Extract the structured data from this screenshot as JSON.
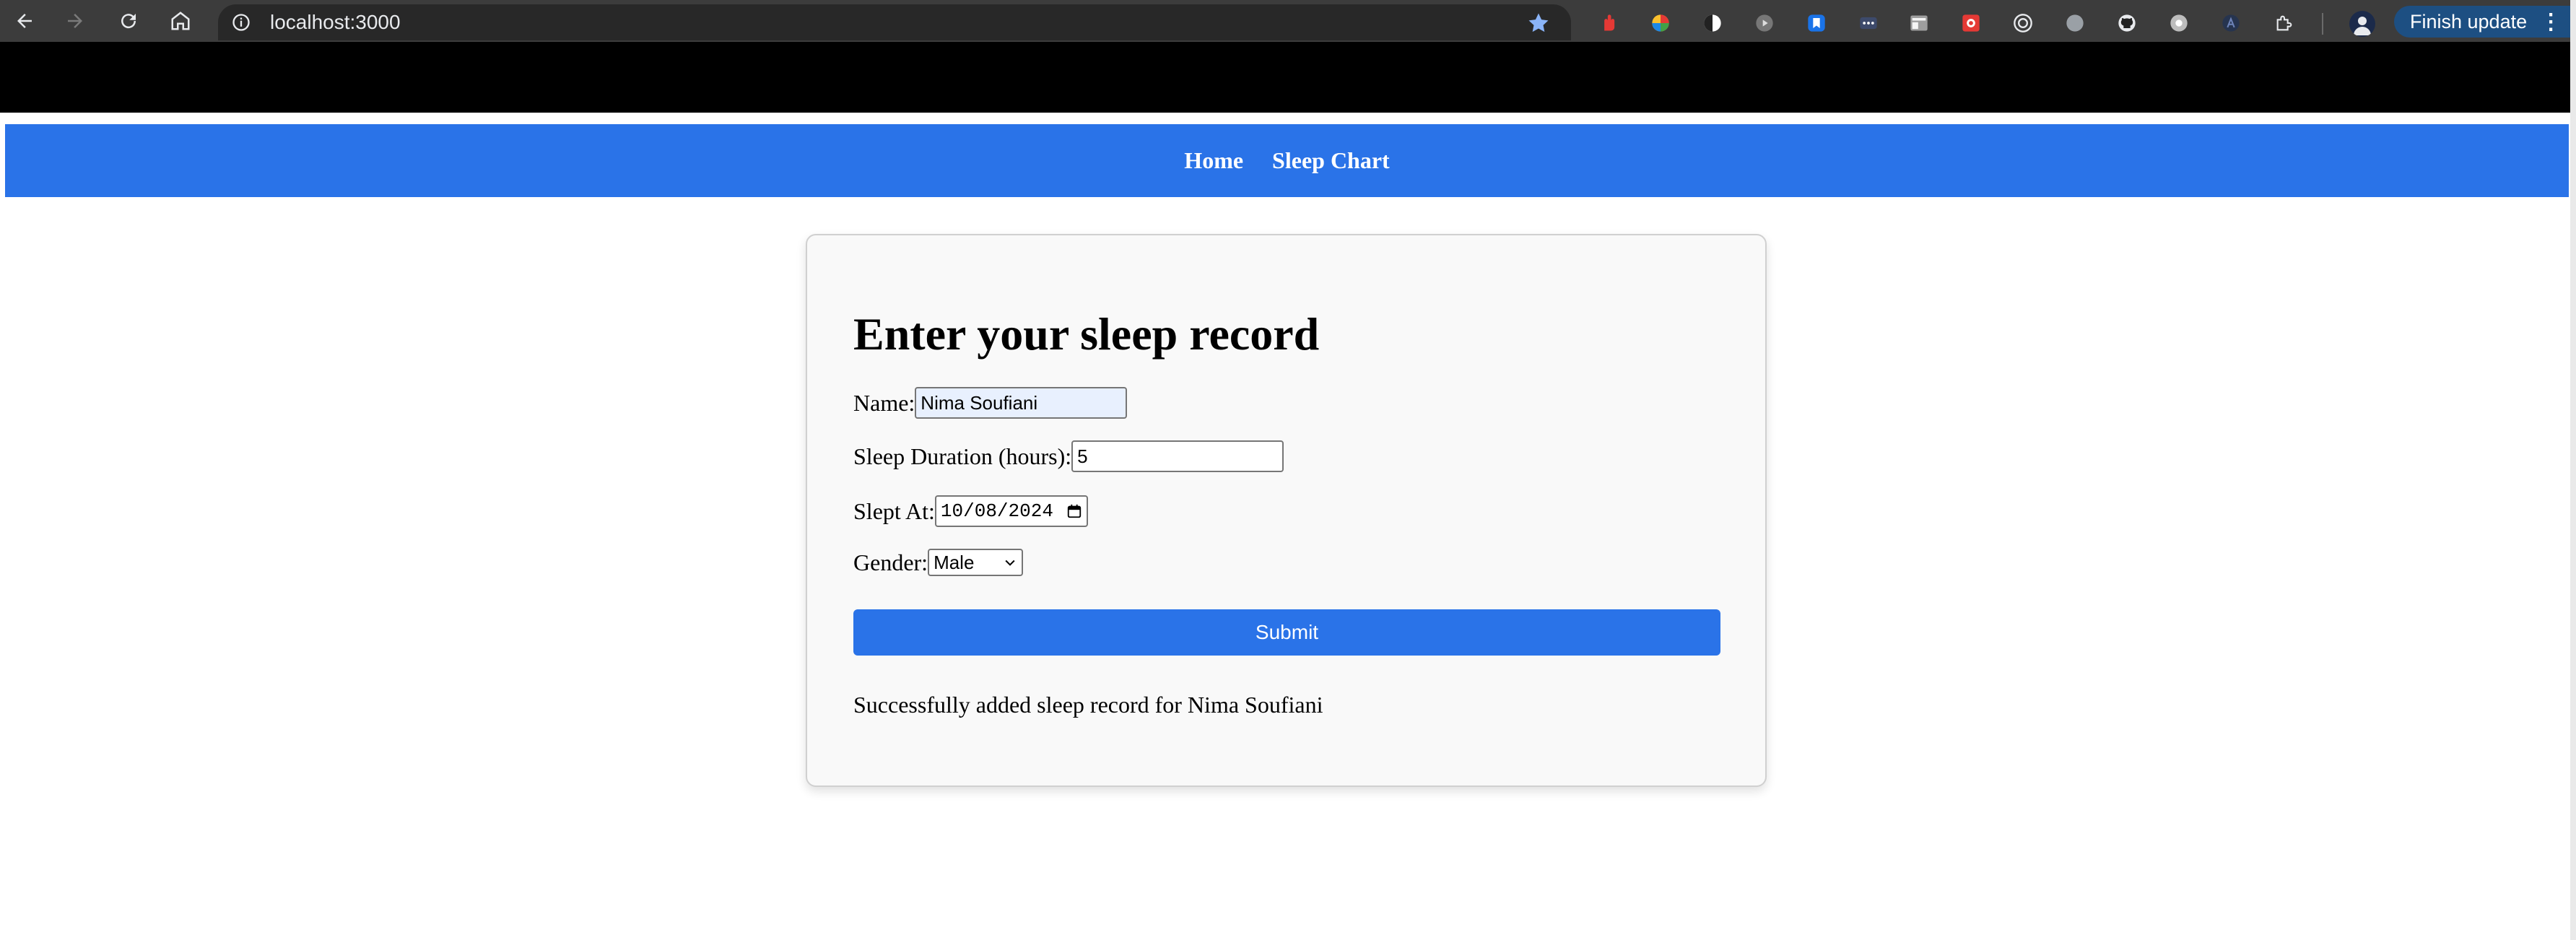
{
  "browser": {
    "url": "localhost:3000",
    "update_button": "Finish update",
    "icons": [
      "back-arrow-icon",
      "forward-arrow-icon",
      "reload-icon",
      "home-icon",
      "site-info-icon",
      "bookmark-star-icon",
      "extensions-puzzle-icon",
      "menu-kebab-icon"
    ]
  },
  "nav": {
    "links": [
      {
        "label": "Home"
      },
      {
        "label": "Sleep Chart"
      }
    ],
    "color": "#2a73e8"
  },
  "form": {
    "title": "Enter your sleep record",
    "name_label": "Name:",
    "name_value": "Nima Soufiani",
    "duration_label": "Sleep Duration (hours):",
    "duration_value": "5",
    "slept_at_label": "Slept At:",
    "slept_at_value": "10/08/2024",
    "gender_label": "Gender:",
    "gender_value": "Male",
    "submit_label": "Submit",
    "success_message": "Successfully added sleep record for Nima Soufiani"
  }
}
